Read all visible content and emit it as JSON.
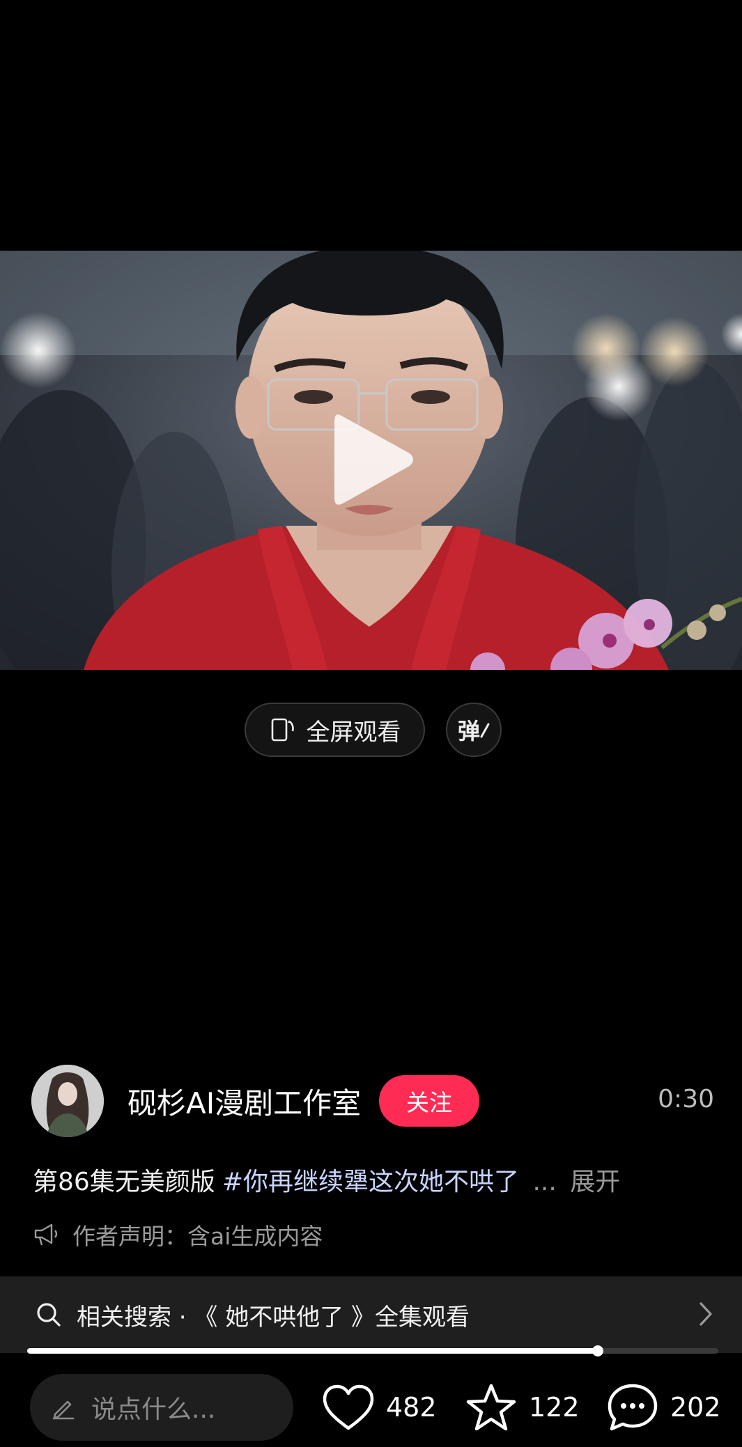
{
  "player": {
    "fullscreen_label": "全屏观看",
    "danmu_label": "弹",
    "progress": 0.826
  },
  "author": {
    "name": "砚杉AI漫剧工作室",
    "follow_label": "关注",
    "duration": "0:30"
  },
  "description": {
    "title": "第86集无美颜版",
    "hashtag": "#你再继续犟这次她不哄了",
    "ellipsis": "...",
    "expand_label": "展开"
  },
  "notice": {
    "text": "作者声明：含ai生成内容"
  },
  "related_search": {
    "text": "相关搜索 · 《 她不哄他了 》全集观看"
  },
  "bottom_bar": {
    "comment_placeholder": "说点什么...",
    "likes": "482",
    "favorites": "122",
    "comments": "202"
  },
  "colors": {
    "background": "#000000",
    "follow": "#fe2c55",
    "hashtag": "#c9d4ff"
  }
}
